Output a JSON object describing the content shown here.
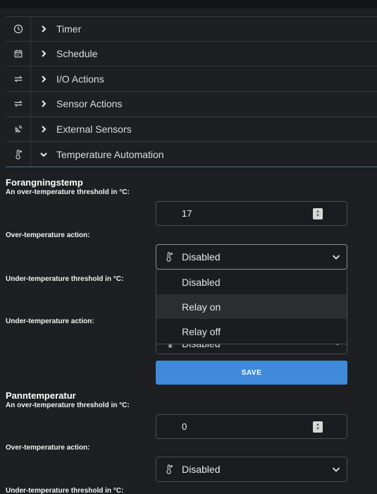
{
  "menu": {
    "items": [
      {
        "label": "Timer",
        "icon": "clock-icon",
        "state": "collapsed"
      },
      {
        "label": "Schedule",
        "icon": "calendar-icon",
        "state": "collapsed"
      },
      {
        "label": "I/O Actions",
        "icon": "swap-arrows-icon",
        "state": "collapsed"
      },
      {
        "label": "Sensor Actions",
        "icon": "swap-arrows-icon",
        "state": "collapsed"
      },
      {
        "label": "External Sensors",
        "icon": "satellite-icon",
        "state": "collapsed"
      },
      {
        "label": "Temperature Automation",
        "icon": "thermometer-icon",
        "state": "expanded"
      }
    ]
  },
  "sections": [
    {
      "title": "Forangningstemp",
      "over_threshold_label": "An over-temperature threshold in °C:",
      "over_threshold_value": "17",
      "over_action_label": "Over-temperature action:",
      "over_action_value": "Disabled",
      "under_threshold_label": "Under-temperature threshold in °C:",
      "under_action_label": "Under-temperature action:",
      "under_action_value": "Disabled",
      "save_label": "SAVE"
    },
    {
      "title": "Panntemperatur",
      "over_threshold_label": "An over-temperature threshold in °C:",
      "over_threshold_value": "0",
      "over_action_label": "Over-temperature action:",
      "over_action_value": "Disabled",
      "under_threshold_label": "Under-temperature threshold in °C:"
    }
  ],
  "dropdown": {
    "options": [
      "Disabled",
      "Relay on",
      "Relay off"
    ],
    "hovered": "Relay on"
  },
  "colors": {
    "background": "#1e1f22",
    "accent": "#3f8bd9",
    "border": "#4a4d53"
  }
}
